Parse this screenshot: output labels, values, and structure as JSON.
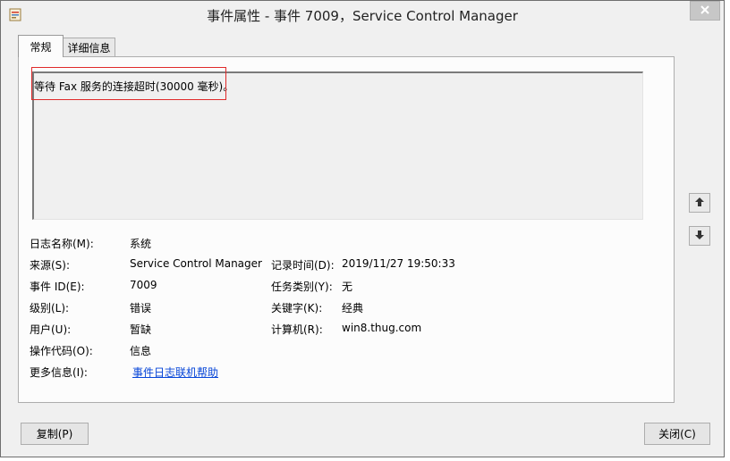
{
  "window": {
    "title": "事件属性 - 事件 7009，Service Control Manager"
  },
  "tabs": [
    {
      "label": "常规"
    },
    {
      "label": "详细信息"
    }
  ],
  "description": "等待 Fax 服务的连接超时(30000 毫秒)。",
  "fields": {
    "log_name": {
      "label": "日志名称(M):",
      "value": "系统"
    },
    "source": {
      "label": "来源(S):",
      "value": "Service Control Manager"
    },
    "logged": {
      "label": "记录时间(D):",
      "value": "2019/11/27 19:50:33"
    },
    "event_id": {
      "label": "事件 ID(E):",
      "value": "7009"
    },
    "task_category": {
      "label": "任务类别(Y):",
      "value": "无"
    },
    "level": {
      "label": "级别(L):",
      "value": "错误"
    },
    "keywords": {
      "label": "关键字(K):",
      "value": "经典"
    },
    "user": {
      "label": "用户(U):",
      "value": "暂缺"
    },
    "computer": {
      "label": "计算机(R):",
      "value": "win8.thug.com"
    },
    "opcode": {
      "label": "操作代码(O):",
      "value": "信息"
    },
    "more_info": {
      "label": "更多信息(I):",
      "value": "事件日志联机帮助"
    }
  },
  "buttons": {
    "copy": "复制(P)",
    "close": "关闭(C)"
  },
  "icons": {
    "app": "event-viewer-icon",
    "close": "close-icon",
    "up": "arrow-up-icon",
    "down": "arrow-down-icon"
  },
  "colors": {
    "highlight": "#e02a2a",
    "link": "#0645d8"
  }
}
